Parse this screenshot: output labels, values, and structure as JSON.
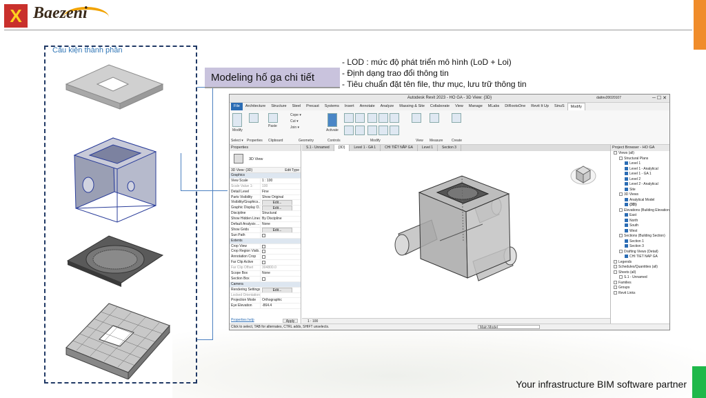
{
  "header": {
    "logo_mark": "X",
    "logo_text": "Baezeni"
  },
  "components": {
    "label": "Cấu kiện thành phần"
  },
  "model_title": "Modeling hố ga chi tiết",
  "bullets": [
    "- LOD : mức độ phát triển mô hình (LoD + Loi)",
    "- Định dạng trao đổi thông tin",
    "- Tiêu chuẩn đặt tên file, thư mục, lưu trữ thông tin"
  ],
  "tagline": "Your infrastructure BIM software partner",
  "revit": {
    "title": "Autodesk Revit 2023 - HO GA - 3D View: {3D}",
    "user": "dattnv20020107",
    "tabs": [
      "File",
      "Architecture",
      "Structure",
      "Steel",
      "Precast",
      "Systems",
      "Insert",
      "Annotate",
      "Analyze",
      "Massing & Site",
      "Collaborate",
      "View",
      "Manage",
      "MLabs",
      "DiRootsOne",
      "Revit It Up",
      "SinuS",
      "Modify"
    ],
    "ribbon": {
      "groups": [
        "Select ▾",
        "Properties",
        "Clipboard",
        "Geometry",
        "Controls",
        "Modify",
        "View",
        "Measure",
        "Create"
      ],
      "buttons": [
        "Modify",
        "Paste",
        "Cope ▾",
        "Cut ▾",
        "Join ▾",
        "Activate"
      ]
    },
    "properties": {
      "header": "Properties",
      "type": "3D View",
      "filter": "3D View: {3D}",
      "edit_type": "Edit Type",
      "rows": [
        {
          "k": "Graphics",
          "group": true
        },
        {
          "k": "View Scale",
          "v": "1 : 100"
        },
        {
          "k": "Scale Value    1:",
          "v": "100",
          "dis": true
        },
        {
          "k": "Detail Level",
          "v": "Fine"
        },
        {
          "k": "Parts Visibility",
          "v": "Show Original"
        },
        {
          "k": "Visibility/Graphics...",
          "btn": "Edit..."
        },
        {
          "k": "Graphic Display O...",
          "btn": "Edit..."
        },
        {
          "k": "Discipline",
          "v": "Structural"
        },
        {
          "k": "Show Hidden Lines",
          "v": "By Discipline"
        },
        {
          "k": "Default Analysis ...",
          "v": "None"
        },
        {
          "k": "Show Grids",
          "btn": "Edit..."
        },
        {
          "k": "Sun Path",
          "cb": true
        },
        {
          "k": "Extents",
          "group": true
        },
        {
          "k": "Crop View",
          "cb": true
        },
        {
          "k": "Crop Region Visib...",
          "cb": true
        },
        {
          "k": "Annotation Crop",
          "cb": true
        },
        {
          "k": "Far Clip Active",
          "cb": true
        },
        {
          "k": "Far Clip Offset",
          "v": "304800.0",
          "dis": true
        },
        {
          "k": "Scope Box",
          "v": "None"
        },
        {
          "k": "Section Box",
          "cb": true
        },
        {
          "k": "Camera",
          "group": true
        },
        {
          "k": "Rendering Settings",
          "btn": "Edit..."
        },
        {
          "k": "Locked Orientation",
          "v": "",
          "dis": true
        },
        {
          "k": "Projection Mode",
          "v": "Orthographic"
        },
        {
          "k": "Eye Elevation",
          "v": "-864.4"
        }
      ],
      "help": "Properties help",
      "apply": "Apply"
    },
    "view_tabs": [
      "S.1 - Unnamed",
      "{3D}",
      "Level 1 - GA 1",
      "CHI TIẾT NẮP GA",
      "Level 1",
      "Section 3"
    ],
    "view_scale": "1 : 100",
    "status": "Click to select, TAB for alternates, CTRL adds, SHIFT unselects.",
    "main_model": "Main Model",
    "browser": {
      "header": "Project Browser - HO GA",
      "items": [
        {
          "t": "Views (all)",
          "i": 0
        },
        {
          "t": "Structural Plans",
          "i": 1
        },
        {
          "t": "Level 1",
          "i": 2
        },
        {
          "t": "Level 1 - Analytical",
          "i": 2
        },
        {
          "t": "Level 1 - GA 1",
          "i": 2
        },
        {
          "t": "Level 2",
          "i": 2
        },
        {
          "t": "Level 2 - Analytical",
          "i": 2
        },
        {
          "t": "Site",
          "i": 2
        },
        {
          "t": "3D Views",
          "i": 1
        },
        {
          "t": "Analytical Model",
          "i": 2
        },
        {
          "t": "{3D}",
          "i": 2,
          "bold": true
        },
        {
          "t": "Elevations (Building Elevation)",
          "i": 1
        },
        {
          "t": "East",
          "i": 2
        },
        {
          "t": "North",
          "i": 2
        },
        {
          "t": "South",
          "i": 2
        },
        {
          "t": "West",
          "i": 2
        },
        {
          "t": "Sections (Building Section)",
          "i": 1
        },
        {
          "t": "Section 1",
          "i": 2
        },
        {
          "t": "Section 3",
          "i": 2
        },
        {
          "t": "Drafting Views (Detail)",
          "i": 1
        },
        {
          "t": "CHI TIẾT NẮP GA",
          "i": 2
        },
        {
          "t": "Legends",
          "i": 0
        },
        {
          "t": "Schedules/Quantities (all)",
          "i": 0
        },
        {
          "t": "Sheets (all)",
          "i": 0
        },
        {
          "t": "S.1 - Unnamed",
          "i": 1
        },
        {
          "t": "Families",
          "i": 0
        },
        {
          "t": "Groups",
          "i": 0
        },
        {
          "t": "Revit Links",
          "i": 0
        }
      ]
    }
  }
}
